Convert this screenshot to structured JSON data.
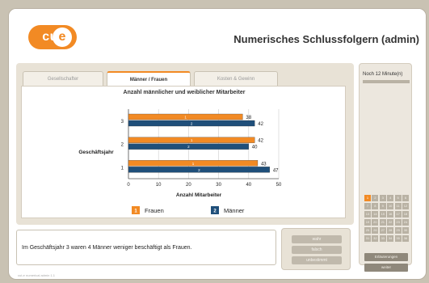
{
  "header": {
    "logo_text": "cut",
    "logo_e": "e",
    "title": "Numerisches Schlussfolgern (admin)"
  },
  "tabs": [
    {
      "label": "Gesellschafter",
      "active": false
    },
    {
      "label": "Männer / Frauen",
      "active": true
    },
    {
      "label": "Kosten & Gewinn",
      "active": false
    }
  ],
  "chart_data": {
    "type": "bar",
    "orientation": "horizontal",
    "title": "Anzahl männlicher und weiblicher Mitarbeiter",
    "xlabel": "Anzahl Mitarbeiter",
    "ylabel": "Geschäftsjahr",
    "categories": [
      "3",
      "2",
      "1"
    ],
    "xlim": [
      0,
      50
    ],
    "xticks": [
      "0",
      "10",
      "20",
      "30",
      "40",
      "50"
    ],
    "series": [
      {
        "name": "Frauen",
        "marker": "1",
        "color": "#f28a24",
        "values": [
          38,
          42,
          43
        ]
      },
      {
        "name": "Männer",
        "marker": "2",
        "color": "#1f4f7a",
        "values": [
          42,
          40,
          47
        ]
      }
    ],
    "legend_position": "bottom"
  },
  "message": {
    "text": "Im Geschäftsjahr 3 waren 4 Männer weniger beschäftigt als Frauen."
  },
  "answers": {
    "buttons": [
      "wahr",
      "falsch",
      "unbestimmt"
    ]
  },
  "sidebar": {
    "timer_label": "Noch 12 Minute(n)",
    "question_numbers": [
      "1",
      "2",
      "3",
      "4",
      "5",
      "6",
      "7",
      "8",
      "9",
      "10",
      "11",
      "12",
      "13",
      "14",
      "15",
      "16",
      "17",
      "18",
      "19",
      "20",
      "21",
      "22",
      "23",
      "24",
      "25",
      "26",
      "27",
      "28",
      "29",
      "30",
      "31",
      "32",
      "33",
      "34",
      "35",
      "36"
    ],
    "current_question": "1",
    "explanation_button": "Erläuterungen",
    "next_button": "weiter"
  },
  "footer": {
    "text": "cut-e numerical admin 1.1"
  },
  "colors": {
    "accent": "#f28a24",
    "navy": "#1f4f7a",
    "frame": "#c9c2b3"
  }
}
